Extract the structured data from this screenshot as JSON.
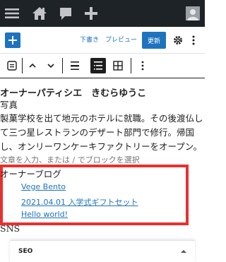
{
  "admin_bar": {
    "icons": [
      "menu-icon",
      "home-icon",
      "comment-icon",
      "add-new-icon",
      "avatar"
    ]
  },
  "editor_topbar": {
    "save_draft_label": "下書き",
    "preview_label": "プレビュー",
    "update_label": "更新",
    "icons": [
      "block-inserter-icon",
      "settings-gear-icon",
      "more-options-icon"
    ]
  },
  "block_toolbar": {
    "tools": [
      "block-type-icon",
      "move-up-icon",
      "move-down-icon",
      "align-icon",
      "list-icon",
      "table-icon",
      "more-icon"
    ]
  },
  "content": {
    "heading": "オーナーパティシエ　きむらゆうこ",
    "photo_label": "写真",
    "bio_lines": [
      "製菓学校を出て地元のホテルに就職。その後渡仏し",
      "て三つ星レストランのデザート部門で修行。帰国",
      "し、オンリーワンケーキファクトリーをオープン。"
    ],
    "placeholder": "文章を入力、または / でブロックを選択",
    "blog_label": "オーナーブログ",
    "blog_links": [
      "Vege Bento",
      "2021.04.01 入学式ギフトセット",
      "Hello world!"
    ],
    "sns_label": "SNS"
  },
  "seo_panel": {
    "title": "SEO"
  },
  "colors": {
    "admin_bar": "#1d2327",
    "accent": "#1e73be",
    "highlight": "#e83030"
  }
}
